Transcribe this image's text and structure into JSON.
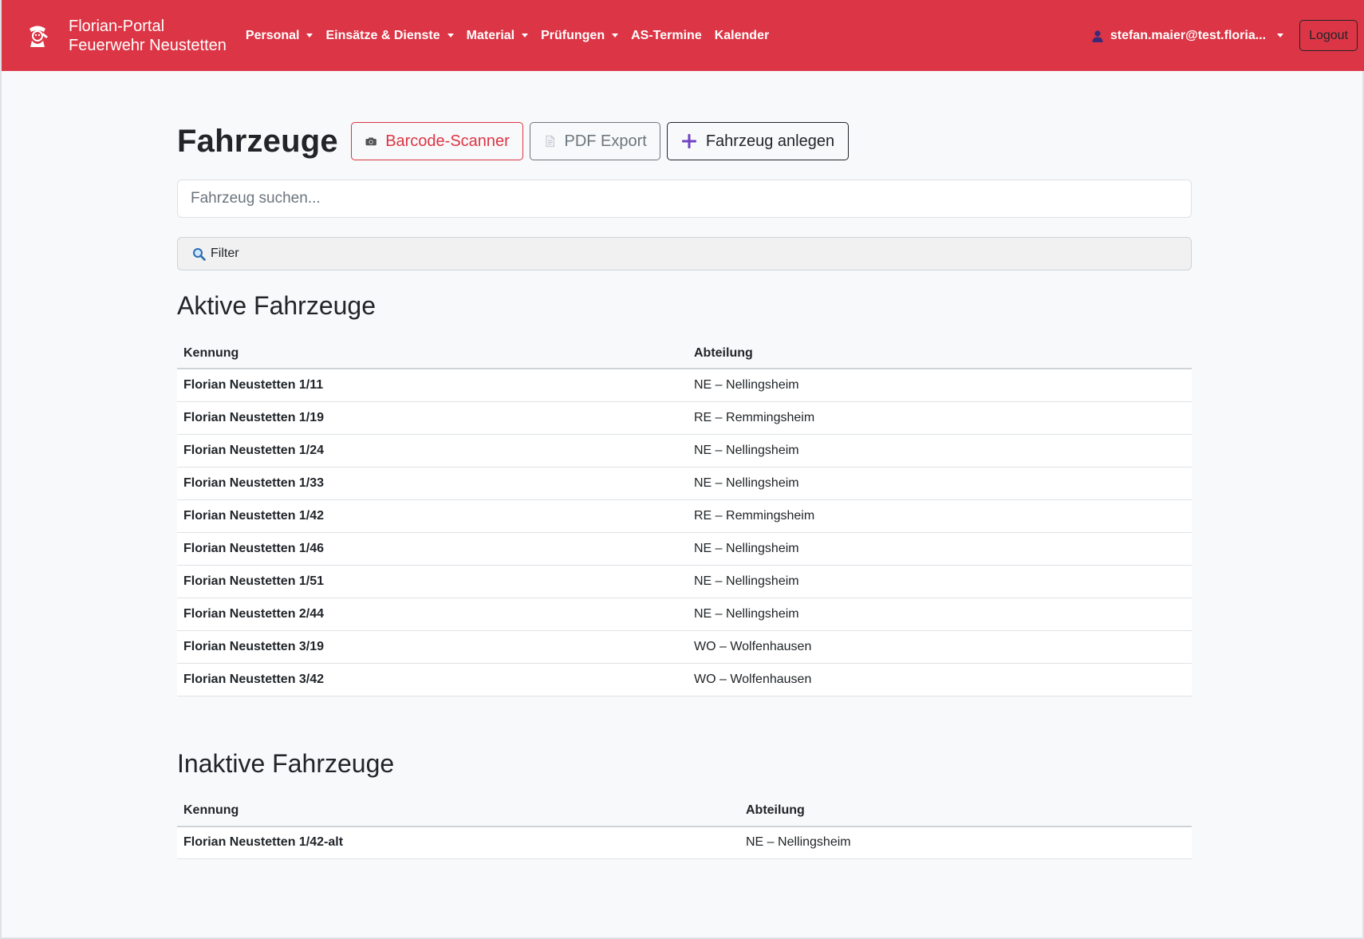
{
  "brand": {
    "line1": "Florian-Portal",
    "line2": "Feuerwehr Neustetten"
  },
  "nav": {
    "items": [
      {
        "label": "Personal",
        "dropdown": true
      },
      {
        "label": "Einsätze & Dienste",
        "dropdown": true
      },
      {
        "label": "Material",
        "dropdown": true
      },
      {
        "label": "Prüfungen",
        "dropdown": true
      },
      {
        "label": "AS-Termine",
        "dropdown": false
      },
      {
        "label": "Kalender",
        "dropdown": false
      }
    ],
    "user": "stefan.maier@test.floria...",
    "logout": "Logout"
  },
  "page": {
    "title": "Fahrzeuge",
    "buttons": {
      "barcode": "Barcode-Scanner",
      "pdf": "PDF Export",
      "create": "Fahrzeug anlegen"
    },
    "search_placeholder": "Fahrzeug suchen...",
    "filter_label": "Filter"
  },
  "active": {
    "title": "Aktive Fahrzeuge",
    "columns": [
      "Kennung",
      "Abteilung"
    ],
    "rows": [
      [
        "Florian Neustetten 1/11",
        "NE – Nellingsheim"
      ],
      [
        "Florian Neustetten 1/19",
        "RE – Remmingsheim"
      ],
      [
        "Florian Neustetten 1/24",
        "NE – Nellingsheim"
      ],
      [
        "Florian Neustetten 1/33",
        "NE – Nellingsheim"
      ],
      [
        "Florian Neustetten 1/42",
        "RE – Remmingsheim"
      ],
      [
        "Florian Neustetten 1/46",
        "NE – Nellingsheim"
      ],
      [
        "Florian Neustetten 1/51",
        "NE – Nellingsheim"
      ],
      [
        "Florian Neustetten 2/44",
        "NE – Nellingsheim"
      ],
      [
        "Florian Neustetten 3/19",
        "WO – Wolfenhausen"
      ],
      [
        "Florian Neustetten 3/42",
        "WO – Wolfenhausen"
      ]
    ]
  },
  "inactive": {
    "title": "Inaktive Fahrzeuge",
    "columns": [
      "Kennung",
      "Abteilung"
    ],
    "rows": [
      [
        "Florian Neustetten 1/42-alt",
        "NE – Nellingsheim"
      ]
    ]
  },
  "colors": {
    "navbar": "#dc3545",
    "danger": "#dc3545",
    "secondary": "#6c757d",
    "dark": "#212529",
    "plus": "#6f42c1"
  },
  "icons": {
    "logo": "firefighter-logo-icon",
    "user": "user-icon",
    "barcode": "camera-icon",
    "pdf": "document-icon",
    "create": "plus-icon",
    "filter": "magnifier-icon"
  }
}
